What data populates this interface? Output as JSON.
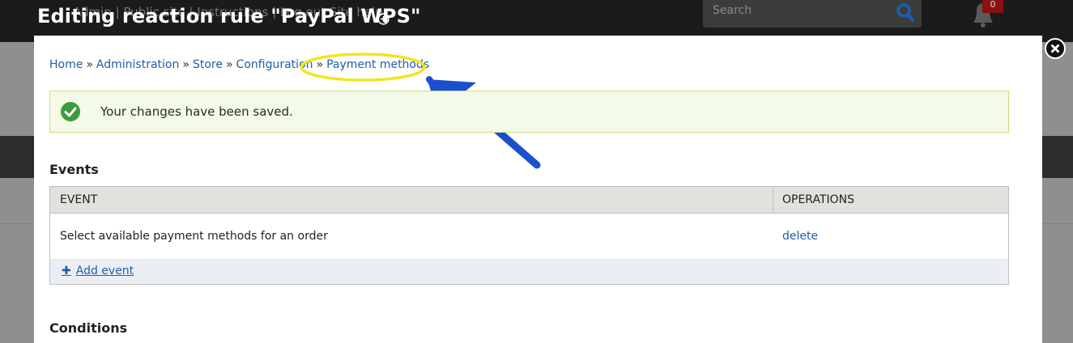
{
  "background": {
    "toolbar_links": "Admin  |  Public site  |  Instructions  |  Log out  Site help",
    "search_placeholder": "Search",
    "notification_count": "0"
  },
  "modal": {
    "title": "Editing reaction rule \"PayPal WPS\"",
    "title_icon": "plus-circle-icon",
    "close_icon": "close-icon"
  },
  "breadcrumb": {
    "items": [
      "Home",
      "Administration",
      "Store",
      "Configuration",
      "Payment methods"
    ],
    "separator": "»"
  },
  "annotation": {
    "highlight_color": "#f0e61e",
    "arrow_color": "#1a4fd0"
  },
  "status": {
    "message": "Your changes have been saved.",
    "icon": "check-circle-icon",
    "color": "#3e9a3c"
  },
  "events": {
    "title": "Events",
    "columns": [
      "EVENT",
      "OPERATIONS"
    ],
    "rows": [
      {
        "event": "Select available payment methods for an order",
        "operation": "delete"
      }
    ],
    "add_label": "Add event"
  },
  "conditions": {
    "title": "Conditions"
  }
}
